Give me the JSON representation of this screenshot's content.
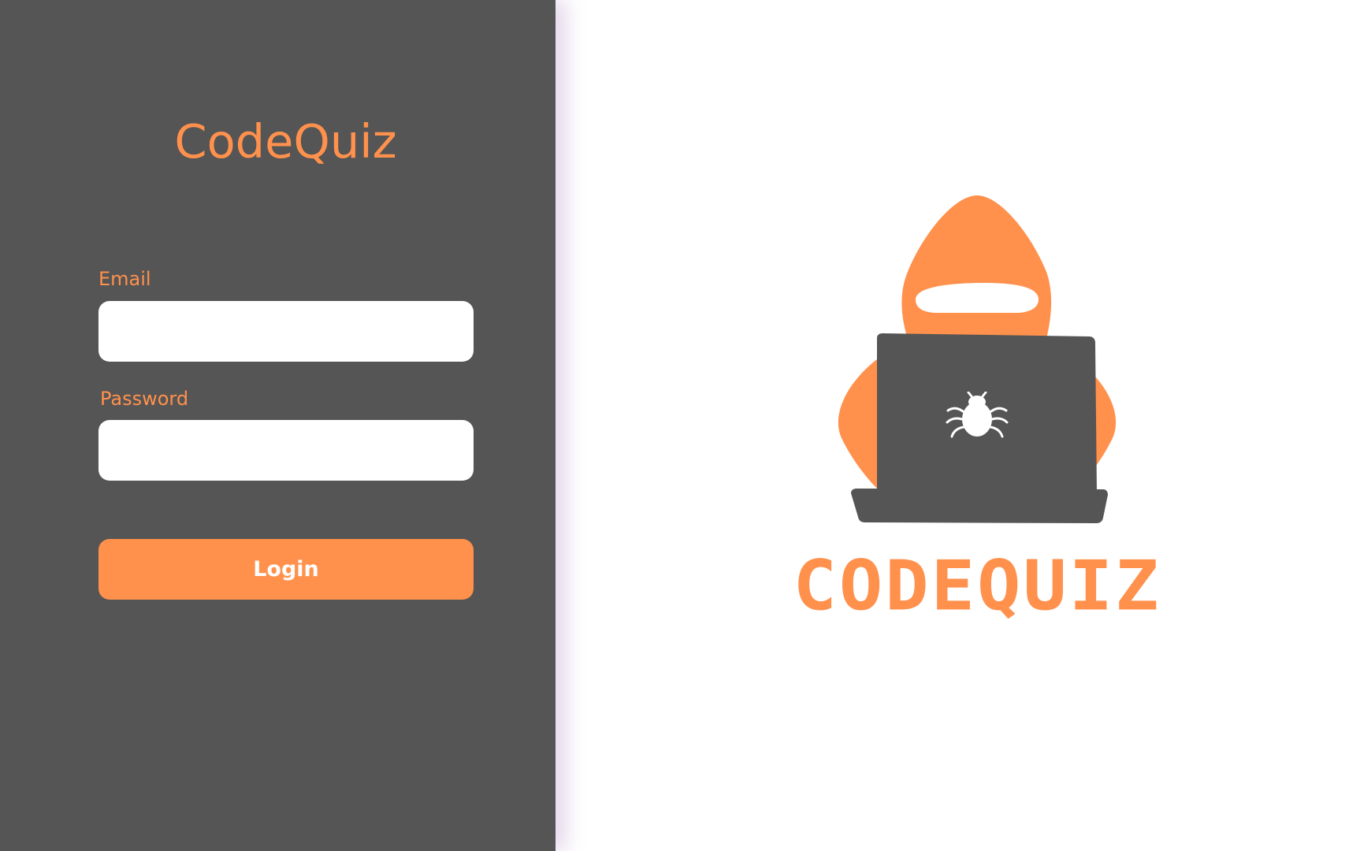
{
  "app": {
    "title": "CodeQuiz"
  },
  "login_form": {
    "email_label": "Email",
    "email_value": "",
    "password_label": "Password",
    "password_value": "",
    "login_button_label": "Login"
  },
  "logo": {
    "wordmark": "CODEQUIZ",
    "illustration_icon": "hooded-hacker-laptop-icon",
    "bug_icon": "bug-icon"
  },
  "colors": {
    "accent": "#ff914d",
    "panel": "#555555",
    "background": "#ffffff",
    "input_background": "#ffffff",
    "button_text": "#ffffff"
  }
}
